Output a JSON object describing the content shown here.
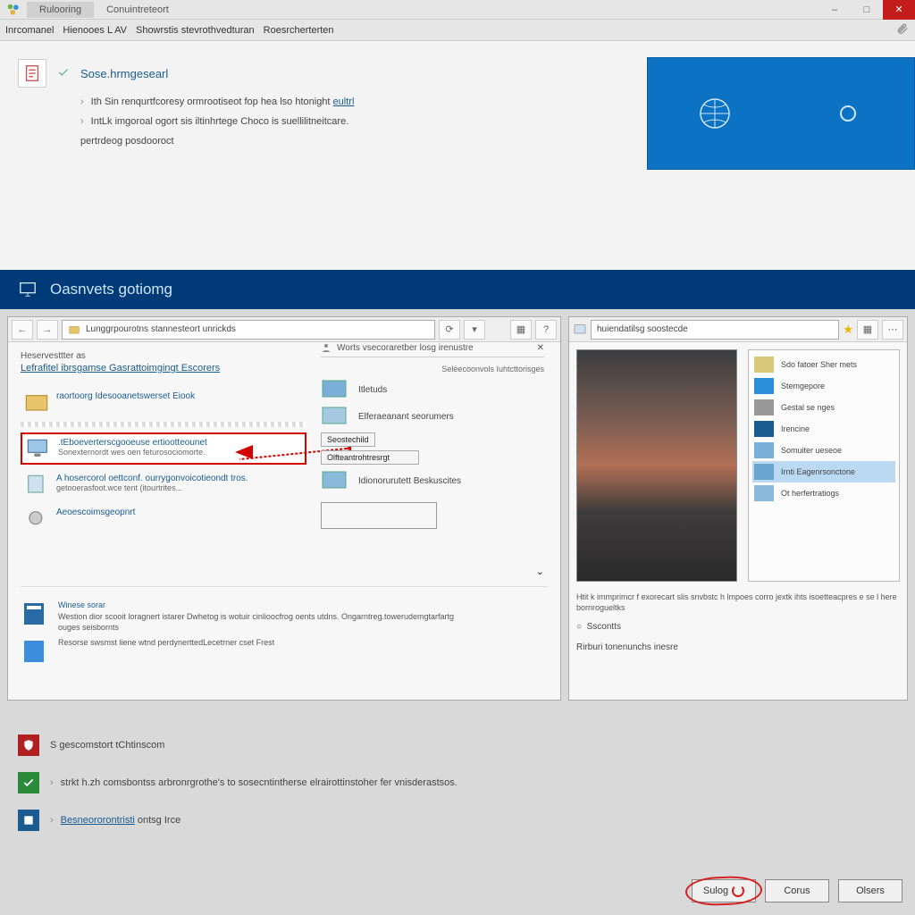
{
  "titlebar": {
    "tabs": [
      "Rulooring",
      "Conuintreteort"
    ],
    "win_min": "–",
    "win_max": "□",
    "win_close": "✕"
  },
  "menubar": {
    "items": [
      "Inrcomanel",
      "Hienooes  L  AV",
      "Showrstis stevrothvedturan",
      "Roesrcherterten"
    ]
  },
  "step1": {
    "title": "Sose.hrmgesearl",
    "desc1": "Ith Sin renqurtfcoresy ormrootiseot fop hea lso htonight",
    "desc1_link": "eultrl",
    "desc2": "IntLk imgoroal ogort sis iltinhrtege Choco is suellilitneitcare.",
    "desc3": "pertrdeog posdooroct"
  },
  "banner": {
    "title": "Oasnvets gotiomg"
  },
  "cp": {
    "address": "Lunggrpourotns stannesteort unrickds",
    "section_label": "Heservesttter as",
    "section_link": "Lefrafitel ibrsgamse Gasrattoimgingt Escorers",
    "right_head": "Worts vsecoraretber losg irenustre",
    "right_sub": "Seléecoonvols Iuhtcttorisges",
    "items": [
      {
        "title": "raortoorg Idesooanetswerset Eiook",
        "sub": ""
      },
      {
        "title": ".tEboeverterscgooeuse ertiootteounet",
        "sub": "Sonexternordt wes oen feturosociomorte.",
        "highlight": true
      },
      {
        "title": "A hosercorol oettconf. ourrygonvoicotieondt tros.",
        "sub": "getooerasfoot.wce tent (itourtrites..."
      },
      {
        "title": "Aeoescoimsgeopnrt",
        "sub": ""
      }
    ],
    "side_items": [
      {
        "label": "Itletuds"
      },
      {
        "label": "Elferaeanant seorumers"
      },
      {
        "label": "Idionorurutett Beskuscites"
      }
    ],
    "side_btn1": "Seostechild",
    "side_btn2": "Olfteantrohtresrgt",
    "bottom": {
      "title": "Winese sorar",
      "line1": "Westion dior scooit loragnert istarer Dwhetog is wotuir cinlioocfrog oents utdns. Ongarntreg.towerudemgtarfartg",
      "line2": "ouges seisbornts",
      "line3": "Resorse swsmst liene wtnd perdynerttedLecetrner cset Frest"
    }
  },
  "rp": {
    "address": "huiendatilsg soostecde",
    "list": [
      "Sdo fatoer Sher mets",
      "Stemgepore",
      "Gestal se nges",
      "Irencine",
      "Somuiter ueseoe",
      "Irnti Eagenrsonctone",
      "Ot herfertratiogs"
    ],
    "desc": "Htit k immprimcr f exorecart slis snvbstc h lmpoes corro jextk ihts isoetteacpres e se l here bornrogueltks",
    "radio": "Sscontts",
    "footer": "Rirburi tonenunchs inesre"
  },
  "lower": {
    "item1": "S gescomstort tChtinscom",
    "item2": "strkt h.zh comsbontss arbronrgrothe's to sosecntintherse elrairottinstoher fer vnisderastsos.",
    "item3_link": "Besneororontristi",
    "item3_rest": "ontsg Irce"
  },
  "footer": {
    "btn_save": "Sulog",
    "btn_cancel": "Corus",
    "btn_close": "Olsers"
  }
}
